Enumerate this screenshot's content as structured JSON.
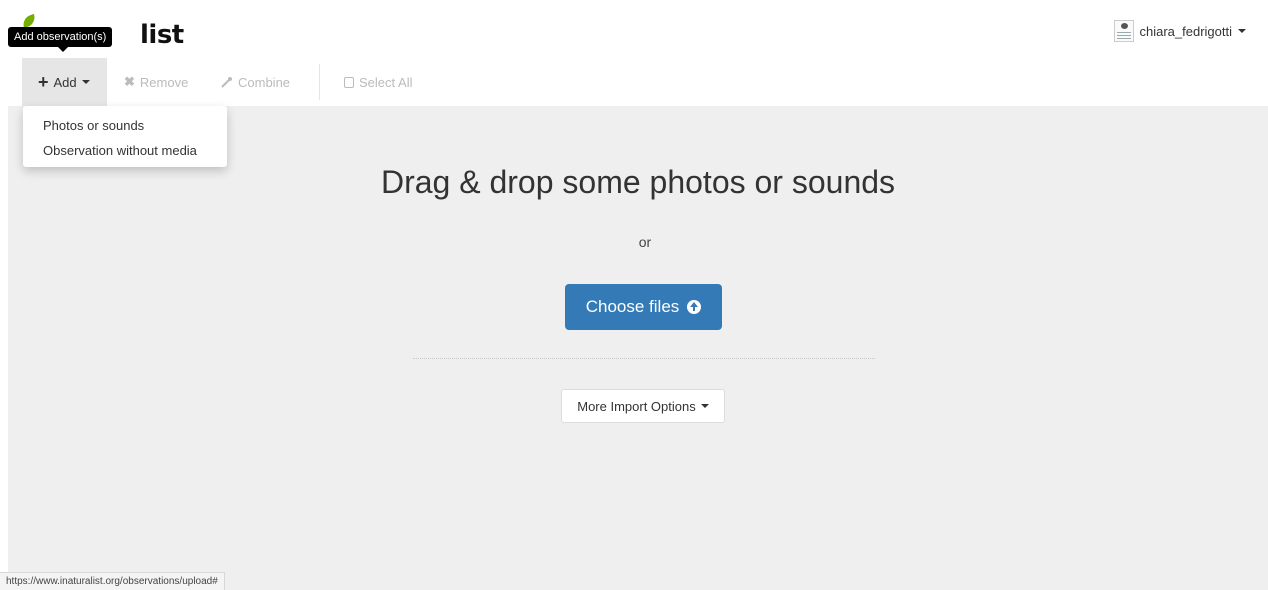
{
  "header": {
    "logo_text": "list",
    "username": "chiara_fedrigotti"
  },
  "tooltip": {
    "text": "Add observation(s)"
  },
  "toolbar": {
    "add_label": "Add",
    "remove_label": "Remove",
    "combine_label": "Combine",
    "select_all_label": "Select All"
  },
  "add_menu": {
    "items": [
      {
        "label": "Photos or sounds"
      },
      {
        "label": "Observation without media"
      }
    ]
  },
  "main": {
    "drop_title": "Drag & drop some photos or sounds",
    "or_text": "or",
    "choose_files_label": "Choose files",
    "more_import_label": "More Import Options"
  },
  "status_bar": {
    "url": "https://www.inaturalist.org/observations/upload#"
  },
  "colors": {
    "primary_button": "#337ab7",
    "drop_area_bg": "#efefef",
    "logo_leaf": "#74ac00"
  }
}
